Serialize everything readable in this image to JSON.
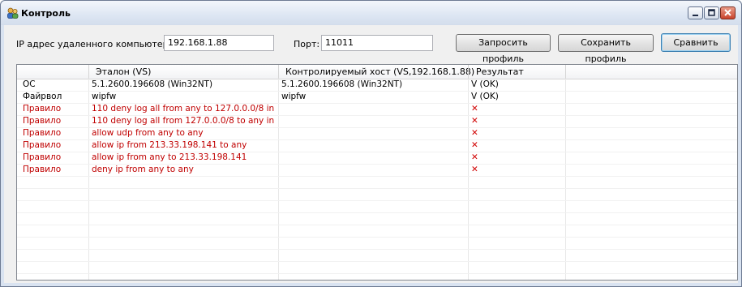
{
  "window": {
    "title": "Контроль"
  },
  "form": {
    "ip_label": "IP адрес удаленного компьютера:",
    "ip_value": "192.168.1.88",
    "port_label": "Порт:",
    "port_value": "11011",
    "request_button": "Запросить профиль",
    "save_button": "Сохранить профиль",
    "compare_button": "Сравнить"
  },
  "table": {
    "columns": [
      "",
      "Эталон (VS)",
      "Контролируемый хост (VS,192.168.1.88)",
      "Результат"
    ],
    "rows": [
      {
        "name": "ОС",
        "reference": "5.1.2600.196608 (Win32NT)",
        "host": "5.1.2600.196608 (Win32NT)",
        "result": "V (OK)",
        "status": "ok"
      },
      {
        "name": "Файрвол",
        "reference": "wipfw",
        "host": "wipfw",
        "result": "V (OK)",
        "status": "ok"
      },
      {
        "name": "Правило",
        "reference": "110 deny log all from any to 127.0.0.0/8 in",
        "host": "",
        "result": "✕",
        "status": "bad"
      },
      {
        "name": "Правило",
        "reference": "110 deny log all from 127.0.0.0/8 to any in",
        "host": "",
        "result": "✕",
        "status": "bad"
      },
      {
        "name": "Правило",
        "reference": "allow udp from any to any",
        "host": "",
        "result": "✕",
        "status": "bad"
      },
      {
        "name": "Правило",
        "reference": "allow ip from 213.33.198.141 to any",
        "host": "",
        "result": "✕",
        "status": "bad"
      },
      {
        "name": "Правило",
        "reference": "allow ip from any to 213.33.198.141",
        "host": "",
        "result": "✕",
        "status": "bad"
      },
      {
        "name": "Правило",
        "reference": "deny ip from any to any",
        "host": "",
        "result": "✕",
        "status": "bad"
      }
    ]
  },
  "colors": {
    "error_text": "#c00000",
    "x_mark": "#d00000"
  }
}
